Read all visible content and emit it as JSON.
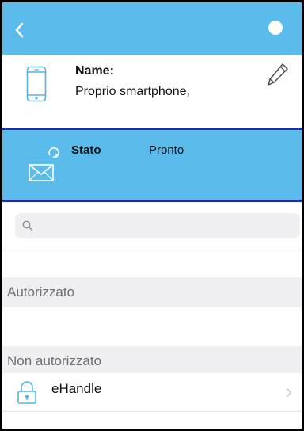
{
  "header": {
    "back_icon": "chevron-left-icon",
    "menu_icon": "circle-icon",
    "color": "#5bbcec"
  },
  "device": {
    "icon": "smartphone-icon",
    "name_label": "Name:",
    "name_value": "Proprio smartphone,",
    "edit_icon": "pencil-icon"
  },
  "status": {
    "icon": "mail-sync-icon",
    "label": "Stato",
    "value": "Pronto",
    "border_color": "#1b2fa6"
  },
  "search": {
    "icon": "search-icon",
    "placeholder": "",
    "value": ""
  },
  "sections": {
    "authorized": "Autorizzato",
    "not_authorized": "Non autorizzato"
  },
  "not_authorized_items": [
    {
      "label": "eHandle",
      "icon": "lock-icon"
    }
  ]
}
